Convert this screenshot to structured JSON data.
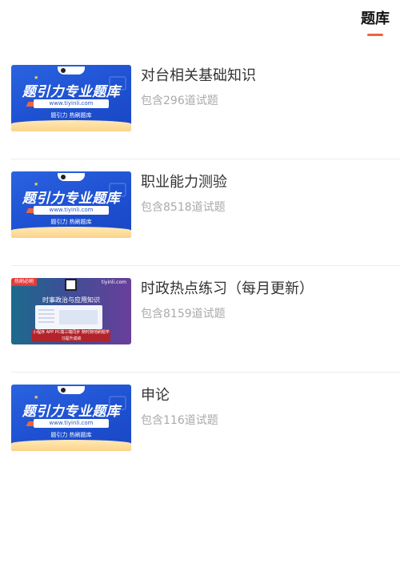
{
  "tabs": [
    {
      "label": "题库",
      "active": true
    }
  ],
  "colors": {
    "accent": "#f0643c",
    "title": "#333333",
    "subtitle": "#aaaaaa",
    "divider": "#ececec"
  },
  "items": [
    {
      "title": "对台相关基础知识",
      "count_text": "包含296道试题",
      "thumbnail": {
        "style": "blue",
        "brand": "题引力专业题库",
        "url": "www.tiyinli.com",
        "slogan": "题引力 热刷题库"
      }
    },
    {
      "title": "职业能力测验",
      "count_text": "包含8518道试题",
      "thumbnail": {
        "style": "blue",
        "brand": "题引力专业题库",
        "url": "www.tiyinli.com",
        "slogan": "题引力 热刷题库"
      }
    },
    {
      "title": "时政热点练习（每月更新）",
      "count_text": "包含8159道试题",
      "thumbnail": {
        "style": "purple",
        "corner": "热刷必刷",
        "site": "tiyinli.com",
        "headline": "时事政治与应用知识",
        "bottom": "小程序 APP PC端三端同步 随时随地刷题学习提升成绩"
      }
    },
    {
      "title": "申论",
      "count_text": "包含116道试题",
      "thumbnail": {
        "style": "blue",
        "brand": "题引力专业题库",
        "url": "www.tiyinli.com",
        "slogan": "题引力 热刷题库"
      }
    }
  ]
}
